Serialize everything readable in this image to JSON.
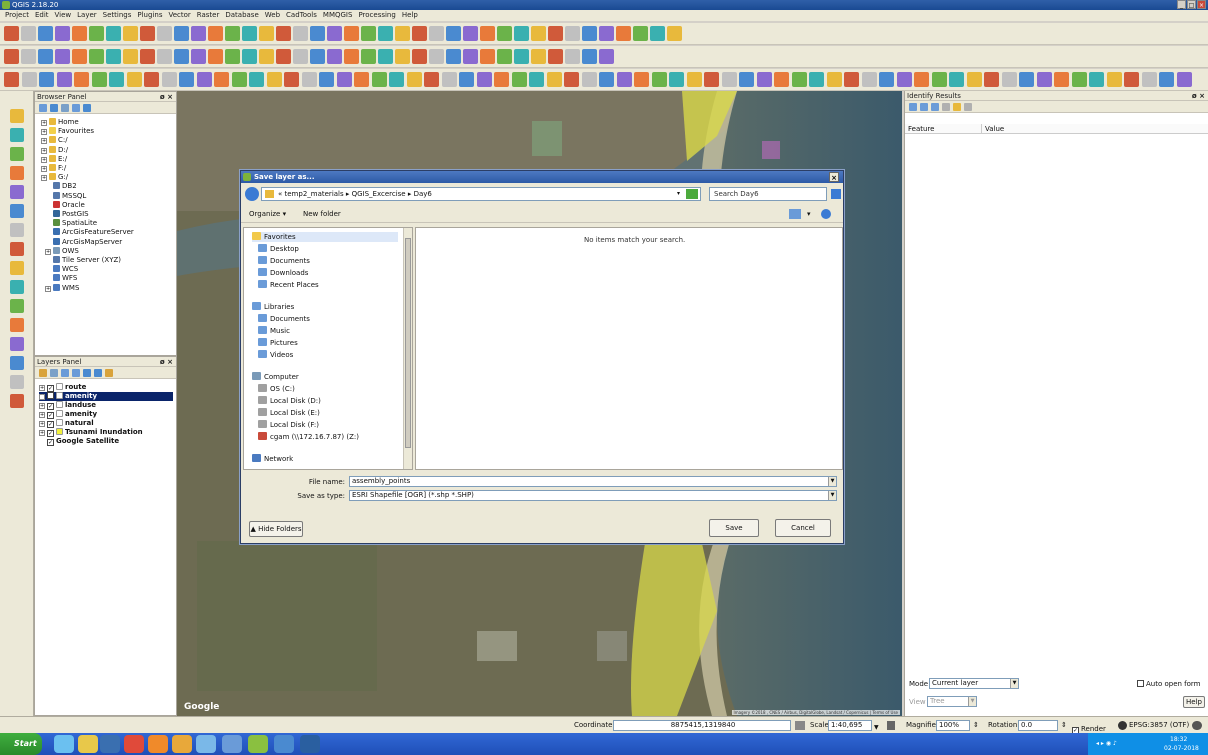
{
  "window": {
    "title": "QGIS 2.18.20",
    "min": "_",
    "max": "□",
    "close": "×"
  },
  "menu": [
    "Project",
    "Edit",
    "View",
    "Layer",
    "Settings",
    "Plugins",
    "Vector",
    "Raster",
    "Database",
    "Web",
    "CadTools",
    "MMQGIS",
    "Processing",
    "Help"
  ],
  "browser_panel": {
    "title": "Browser Panel",
    "items": [
      {
        "label": "Home",
        "color": "#e8b93c"
      },
      {
        "label": "Favourites",
        "color": "#f2d04a"
      },
      {
        "label": "C:/",
        "color": "#e8b93c"
      },
      {
        "label": "D:/",
        "color": "#e8b93c"
      },
      {
        "label": "E:/",
        "color": "#e8b93c"
      },
      {
        "label": "F:/",
        "color": "#e8b93c"
      },
      {
        "label": "G:/",
        "color": "#e8b93c"
      },
      {
        "label": "DB2",
        "color": "#5577aa"
      },
      {
        "label": "MSSQL",
        "color": "#5577aa"
      },
      {
        "label": "Oracle",
        "color": "#cc3333"
      },
      {
        "label": "PostGIS",
        "color": "#336699"
      },
      {
        "label": "SpatiaLite",
        "color": "#5a8f3e"
      },
      {
        "label": "ArcGisFeatureServer",
        "color": "#3a6fb0"
      },
      {
        "label": "ArcGisMapServer",
        "color": "#3a6fb0"
      },
      {
        "label": "OWS",
        "color": "#7a9ab8"
      },
      {
        "label": "Tile Server (XYZ)",
        "color": "#5577aa"
      },
      {
        "label": "WCS",
        "color": "#4a7ac0"
      },
      {
        "label": "WFS",
        "color": "#4a7ac0"
      },
      {
        "label": "WMS",
        "color": "#4a7ac0"
      }
    ]
  },
  "layers_panel": {
    "title": "Layers Panel",
    "layers": [
      {
        "label": "route",
        "bold": true,
        "checked": true,
        "swatch": "#ffffff",
        "selected": false
      },
      {
        "label": "amenity",
        "bold": true,
        "checked": false,
        "swatch": "#ffffff",
        "selected": true
      },
      {
        "label": "landuse",
        "bold": true,
        "checked": true,
        "swatch": "#ffffff",
        "selected": false
      },
      {
        "label": "amenity",
        "bold": true,
        "checked": true,
        "swatch": "#ffffff",
        "selected": false
      },
      {
        "label": "natural",
        "bold": true,
        "checked": true,
        "swatch": "#ffffff",
        "selected": false
      },
      {
        "label": "Tsunami Inundation",
        "bold": true,
        "checked": true,
        "swatch": "#f2f23a",
        "selected": false
      },
      {
        "label": "Google Satellite",
        "bold": true,
        "checked": true,
        "swatch": "none",
        "selected": false
      }
    ]
  },
  "map": {
    "attribution": "Imagery ©2018 , CNES / Airbus, DigitalGlobe, Landsat / Copernicus | Terms of Use",
    "google": "Google"
  },
  "dialog": {
    "title": "Save layer as...",
    "breadcrumb": "« temp2_materials ▸ QGIS_Excercise ▸ Day6",
    "search_placeholder": "Search Day6",
    "organize": "Organize ▾",
    "new_folder": "New folder",
    "empty_message": "No items match your search.",
    "nav": {
      "favorites": "Favorites",
      "fav_items": [
        "Desktop",
        "Documents",
        "Downloads",
        "Recent Places"
      ],
      "libraries": "Libraries",
      "lib_items": [
        "Documents",
        "Music",
        "Pictures",
        "Videos"
      ],
      "computer": "Computer",
      "comp_items": [
        "OS (C:)",
        "Local Disk (D:)",
        "Local Disk (E:)",
        "Local Disk (F:)",
        "cgam (\\\\172.16.7.87) (Z:)"
      ],
      "network": "Network"
    },
    "file_name_label": "File name:",
    "file_name_value": "assembly_points",
    "save_type_label": "Save as type:",
    "save_type_value": "ESRI Shapefile [OGR] (*.shp *.SHP)",
    "hide_folders": "Hide Folders",
    "save": "Save",
    "cancel": "Cancel"
  },
  "identify": {
    "title": "Identify Results",
    "col_feature": "Feature",
    "col_value": "Value",
    "mode_label": "Mode",
    "mode_value": "Current layer",
    "auto_open": "Auto open form",
    "view_label": "View",
    "view_value": "Tree",
    "help": "Help"
  },
  "status": {
    "coordinate_label": "Coordinate",
    "coordinate_value": "8875415,1319840",
    "scale_label": "Scale",
    "scale_value": "1:40,695",
    "magnifier_label": "Magnifier",
    "magnifier_value": "100%",
    "rotation_label": "Rotation",
    "rotation_value": "0.0",
    "render_label": "Render",
    "crs": "EPSG:3857 (OTF)"
  },
  "taskbar": {
    "start": "Start",
    "time": "18:32",
    "date": "02-07-2018"
  },
  "colors": {
    "accent": "#2d5aa6",
    "selected": "#0a246a",
    "inundation": "#e6e635"
  }
}
